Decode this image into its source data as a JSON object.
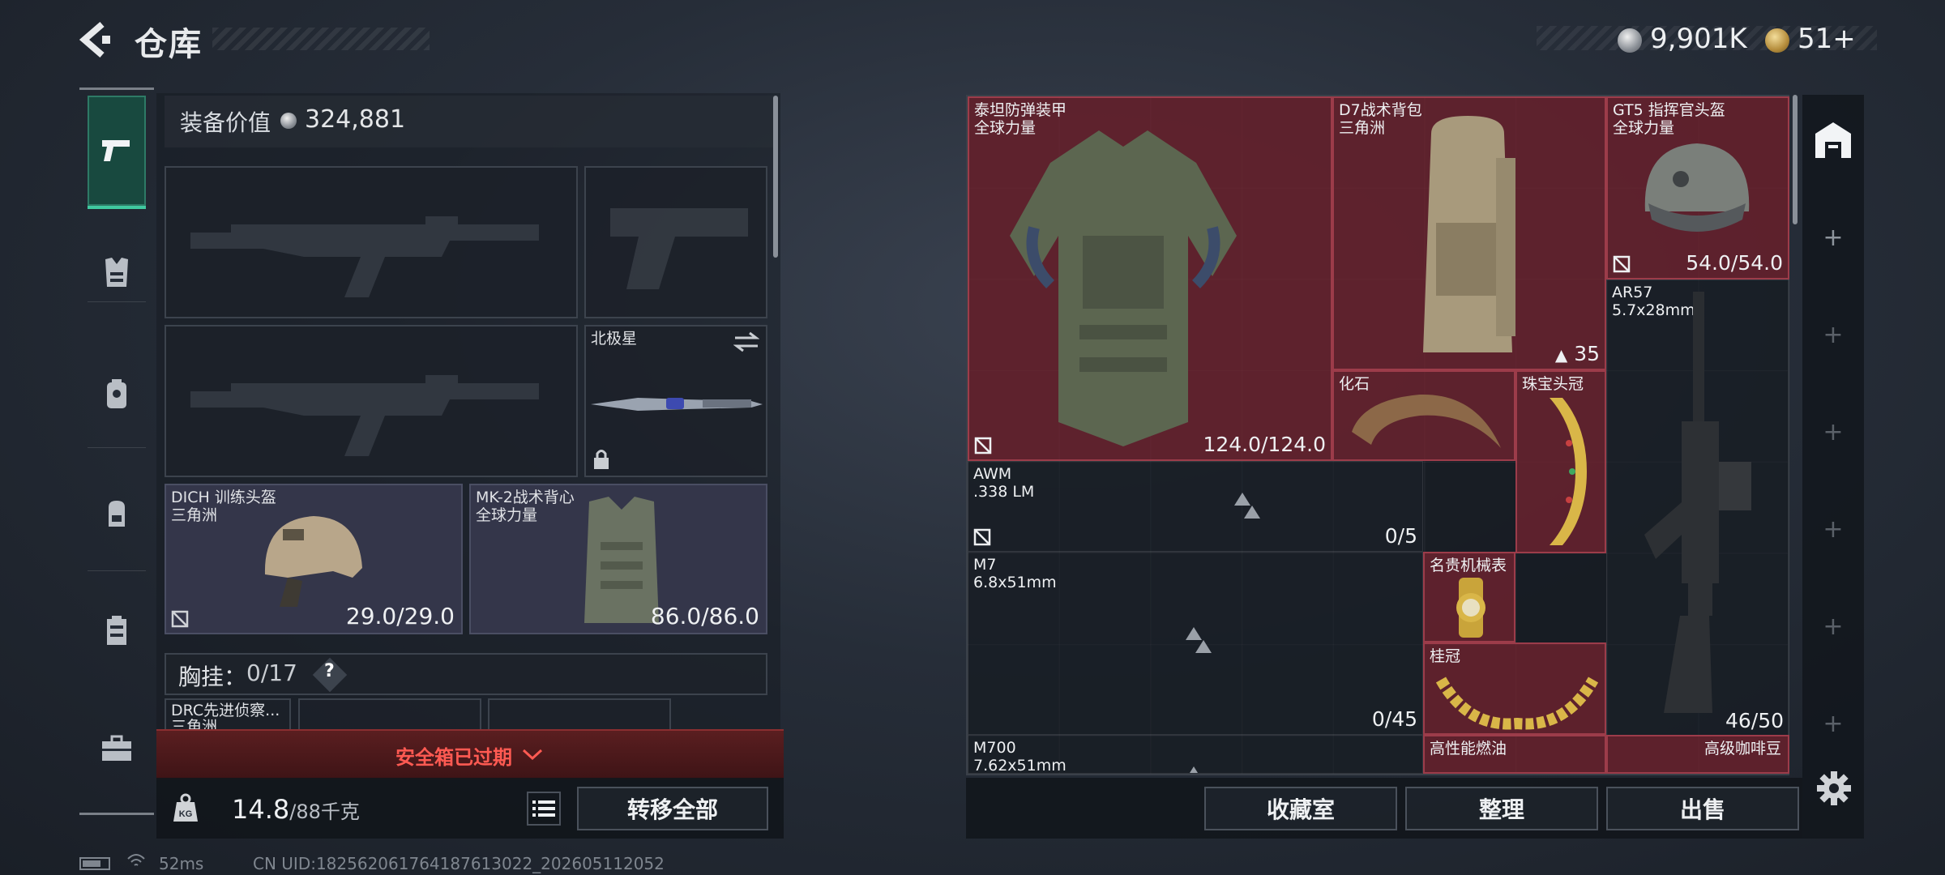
{
  "header": {
    "title": "仓库"
  },
  "currency": [
    {
      "icon": "silver-coin-icon",
      "value": "9,901K"
    },
    {
      "icon": "gold-coin-icon",
      "value": "51+"
    }
  ],
  "left_nav": [
    {
      "icon": "pistol-icon",
      "selected": true
    },
    {
      "icon": "vest-icon"
    },
    {
      "icon": "armor-icon"
    },
    {
      "icon": "backpack-icon"
    },
    {
      "icon": "rig-icon"
    },
    {
      "icon": "case-icon"
    }
  ],
  "loadout": {
    "value_label": "装备价值",
    "value": "324,881",
    "melee": {
      "name": "北极星"
    },
    "helmet": {
      "name": "DICH 训练头盔",
      "faction": "三角洲",
      "durability": "29.0/29.0"
    },
    "armor": {
      "name": "MK-2战术背心",
      "faction": "全球力量",
      "durability": "86.0/86.0"
    },
    "chest_label": "胸挂：",
    "chest_value": "0/17",
    "chest_help": "?",
    "rig_item": {
      "name": "DRC先进侦察...",
      "faction": "三角洲"
    },
    "safebox_text": "安全箱已过期",
    "weight_value": "14.8",
    "weight_max": "/88千克",
    "transfer_all": "转移全部"
  },
  "stash": {
    "items": [
      {
        "name": "泰坦防弹装甲",
        "sub": "全球力量",
        "count": "124.0/124.0"
      },
      {
        "name": "D7战术背包",
        "sub": "三角洲",
        "count": "35"
      },
      {
        "name": "GT5 指挥官头盔",
        "sub": "全球力量",
        "count": "54.0/54.0"
      },
      {
        "name": "AR57",
        "sub": "5.7x28mm",
        "count": "46/50"
      },
      {
        "name": "化石"
      },
      {
        "name": "珠宝头冠"
      },
      {
        "name": "AWM",
        "sub": ".338 LM",
        "count": "0/5"
      },
      {
        "name": "M7",
        "sub": "6.8x51mm",
        "count": "0/45"
      },
      {
        "name": "名贵机械表"
      },
      {
        "name": "桂冠"
      },
      {
        "name": "M700",
        "sub": "7.62x51mm"
      },
      {
        "name": "高性能燃油"
      },
      {
        "name": "高级咖啡豆"
      }
    ]
  },
  "buttons": {
    "collection": "收藏室",
    "organize": "整理",
    "sell": "出售"
  },
  "status_bar": {
    "ping": "52ms",
    "uid": "CN UID:182562061764187613022_202605112052"
  },
  "colors": {
    "accent": "#40c9a0",
    "stash_red": "#7a2430",
    "warning": "#ff5a52"
  }
}
